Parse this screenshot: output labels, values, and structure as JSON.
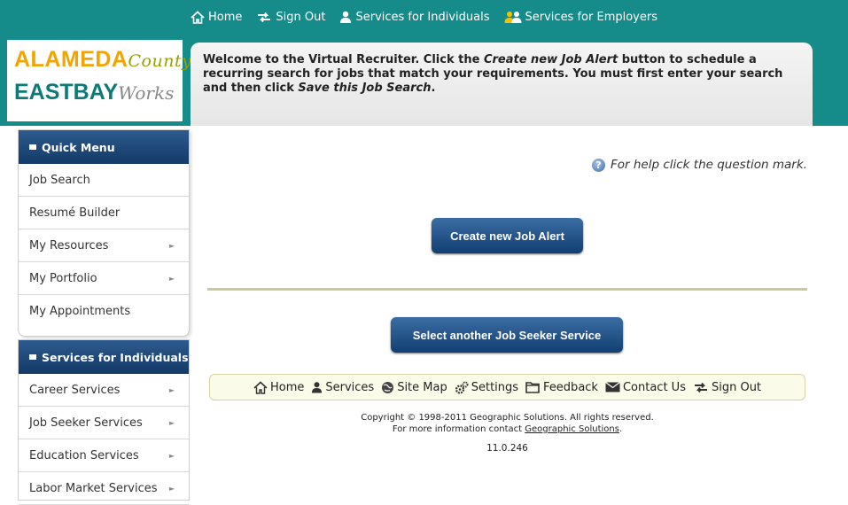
{
  "topnav": {
    "home": "Home",
    "sign_out": "Sign Out",
    "services_individuals": "Services for Individuals",
    "services_employers": "Services for Employers"
  },
  "logo": {
    "line1_bold": "ALAMEDA",
    "line1_script": "County",
    "line2_bold": "EASTBAY",
    "line2_script": "Works"
  },
  "welcome": {
    "part1": "Welcome to the Virtual Recruiter. Click the ",
    "em1": "Create new Job Alert",
    "part2": " button to schedule a recurring search for jobs that match your requirements. You must first enter your search and then click ",
    "em2": "Save this Job Search",
    "part3": "."
  },
  "quick_menu": {
    "title": "Quick Menu",
    "items": [
      {
        "label": "Job Search"
      },
      {
        "label": "Resumé Builder"
      },
      {
        "label": "My Resources"
      },
      {
        "label": "My Portfolio"
      },
      {
        "label": "My Appointments"
      }
    ]
  },
  "services_menu": {
    "title": "Services for Individuals",
    "items": [
      {
        "label": "Career Services"
      },
      {
        "label": "Job Seeker Services"
      },
      {
        "label": "Education Services"
      },
      {
        "label": "Labor Market Services"
      }
    ]
  },
  "help": {
    "icon_glyph": "?",
    "text": "For help click the question mark."
  },
  "buttons": {
    "create_alert": "Create new Job Alert",
    "select_service": "Select another Job Seeker Service"
  },
  "footer": {
    "home": "Home",
    "services": "Services",
    "site_map": "Site Map",
    "settings": "Settings",
    "feedback": "Feedback",
    "contact_us": "Contact Us",
    "sign_out": "Sign Out"
  },
  "copyright": {
    "line1": "Copyright © 1998-2011 Geographic Solutions. All rights reserved.",
    "line2_prefix": "For more information contact ",
    "link": "Geographic Solutions",
    "line2_suffix": ".",
    "version": "11.0.246"
  },
  "colors": {
    "teal": "#168c8a",
    "button_navy": "#133a68",
    "logo_orange": "#f2a400"
  }
}
